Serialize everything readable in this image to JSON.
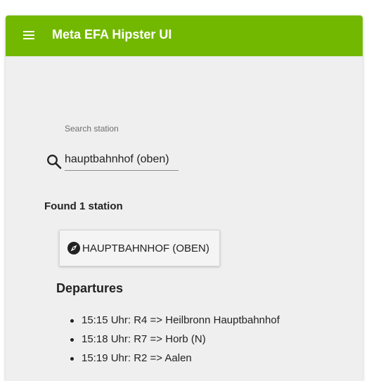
{
  "app": {
    "title": "Meta EFA Hipster UI",
    "accent_color": "#73b800",
    "menu_icon": "menu-icon"
  },
  "search": {
    "label": "Search station",
    "value": "hauptbahnhof (oben)",
    "icon": "search-icon"
  },
  "results": {
    "summary": "Found 1 station",
    "stations": [
      {
        "label": "HAUPTBAHNHOF (OBEN)",
        "icon": "compass-icon"
      }
    ]
  },
  "departures": {
    "title": "Departures",
    "items": [
      "15:15 Uhr: R4 => Heilbronn Hauptbahnhof",
      "15:18 Uhr: R7 => Horb (N)",
      "15:19 Uhr: R2 => Aalen"
    ]
  }
}
